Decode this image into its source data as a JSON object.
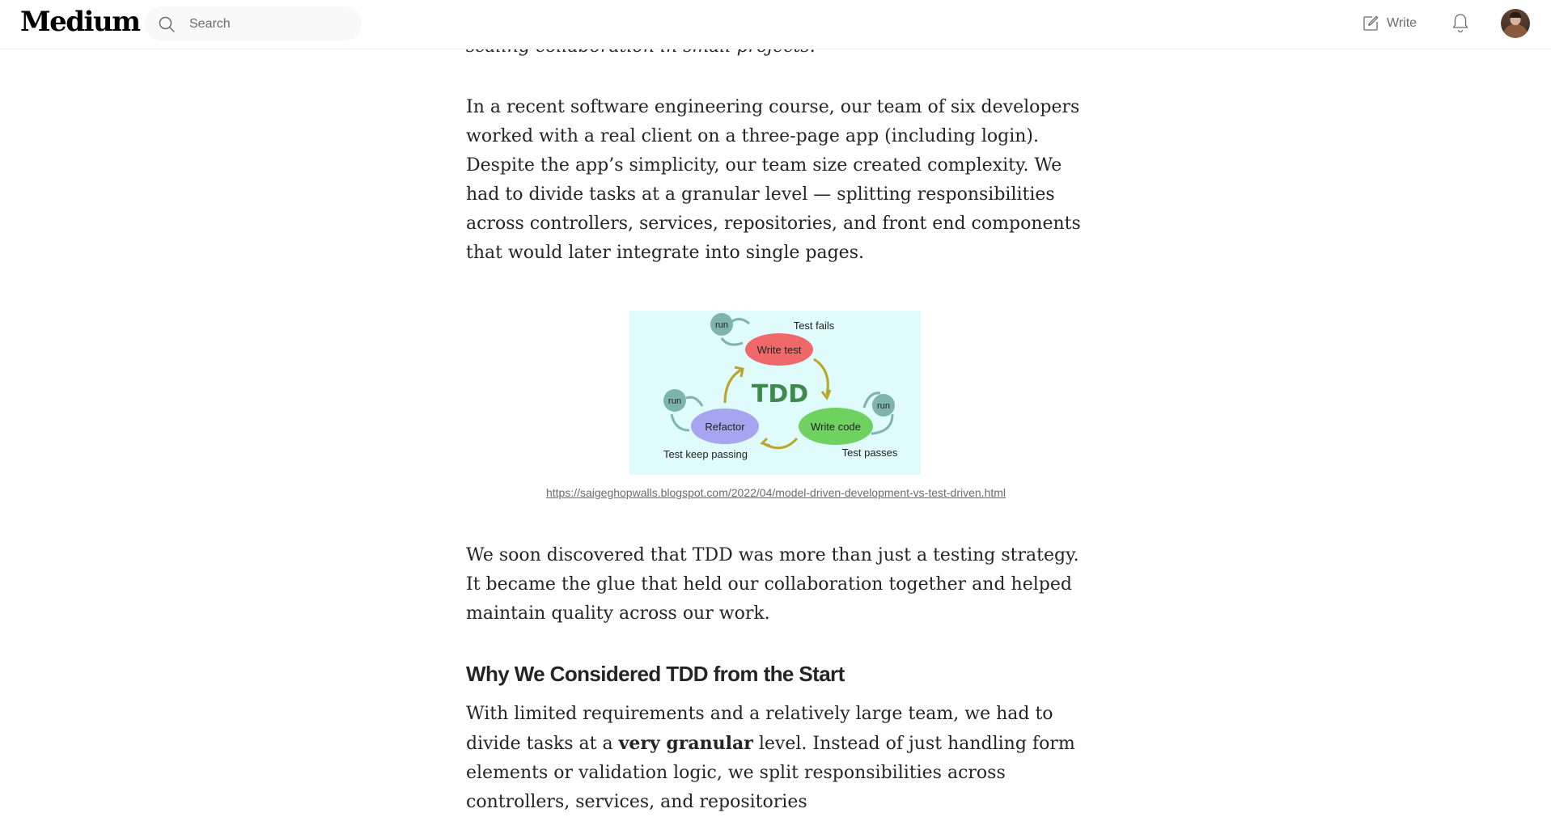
{
  "header": {
    "logo": "Medium",
    "search_placeholder": "Search",
    "write_label": "Write"
  },
  "article": {
    "intro_fragment": "scaling collaboration in small projects.",
    "para1": "In a recent software engineering course, our team of six developers worked with a real client on a three-page app (including login). Despite the app’s simplicity, our team size created complexity. We had to divide tasks at a granular level — splitting responsibilities across controllers, services, repositories, and front end components that would later integrate into single pages.",
    "figure": {
      "labels": {
        "run": "run",
        "test_fails": "Test fails",
        "write_test": "Write test",
        "tdd": "TDD",
        "refactor": "Refactor",
        "write_code": "Write code",
        "test_keep_passing": "Test keep passing",
        "test_passes": "Test passes"
      },
      "caption": "https://saigeghopwalls.blogspot.com/2022/04/model-driven-development-vs-test-driven.html"
    },
    "para2": "We soon discovered that TDD was more than just a testing strategy. It became the glue that held our collaboration together and helped maintain quality across our work.",
    "heading": "Why We Considered TDD from the Start",
    "para3": {
      "before": "With limited requirements and a relatively large team, we had to divide tasks at a ",
      "bold": "very granular",
      "after": " level. Instead of just handling form elements or validation logic, we split responsibilities across controllers, services, and repositories"
    }
  },
  "colors": {
    "figure_bg": "#dffbfb",
    "write_test_node": "#f0686a",
    "write_code_node": "#6ed160",
    "refactor_node": "#a6a6f0",
    "run_node": "#7fb4ad",
    "tdd_text": "#3e8a4d"
  }
}
